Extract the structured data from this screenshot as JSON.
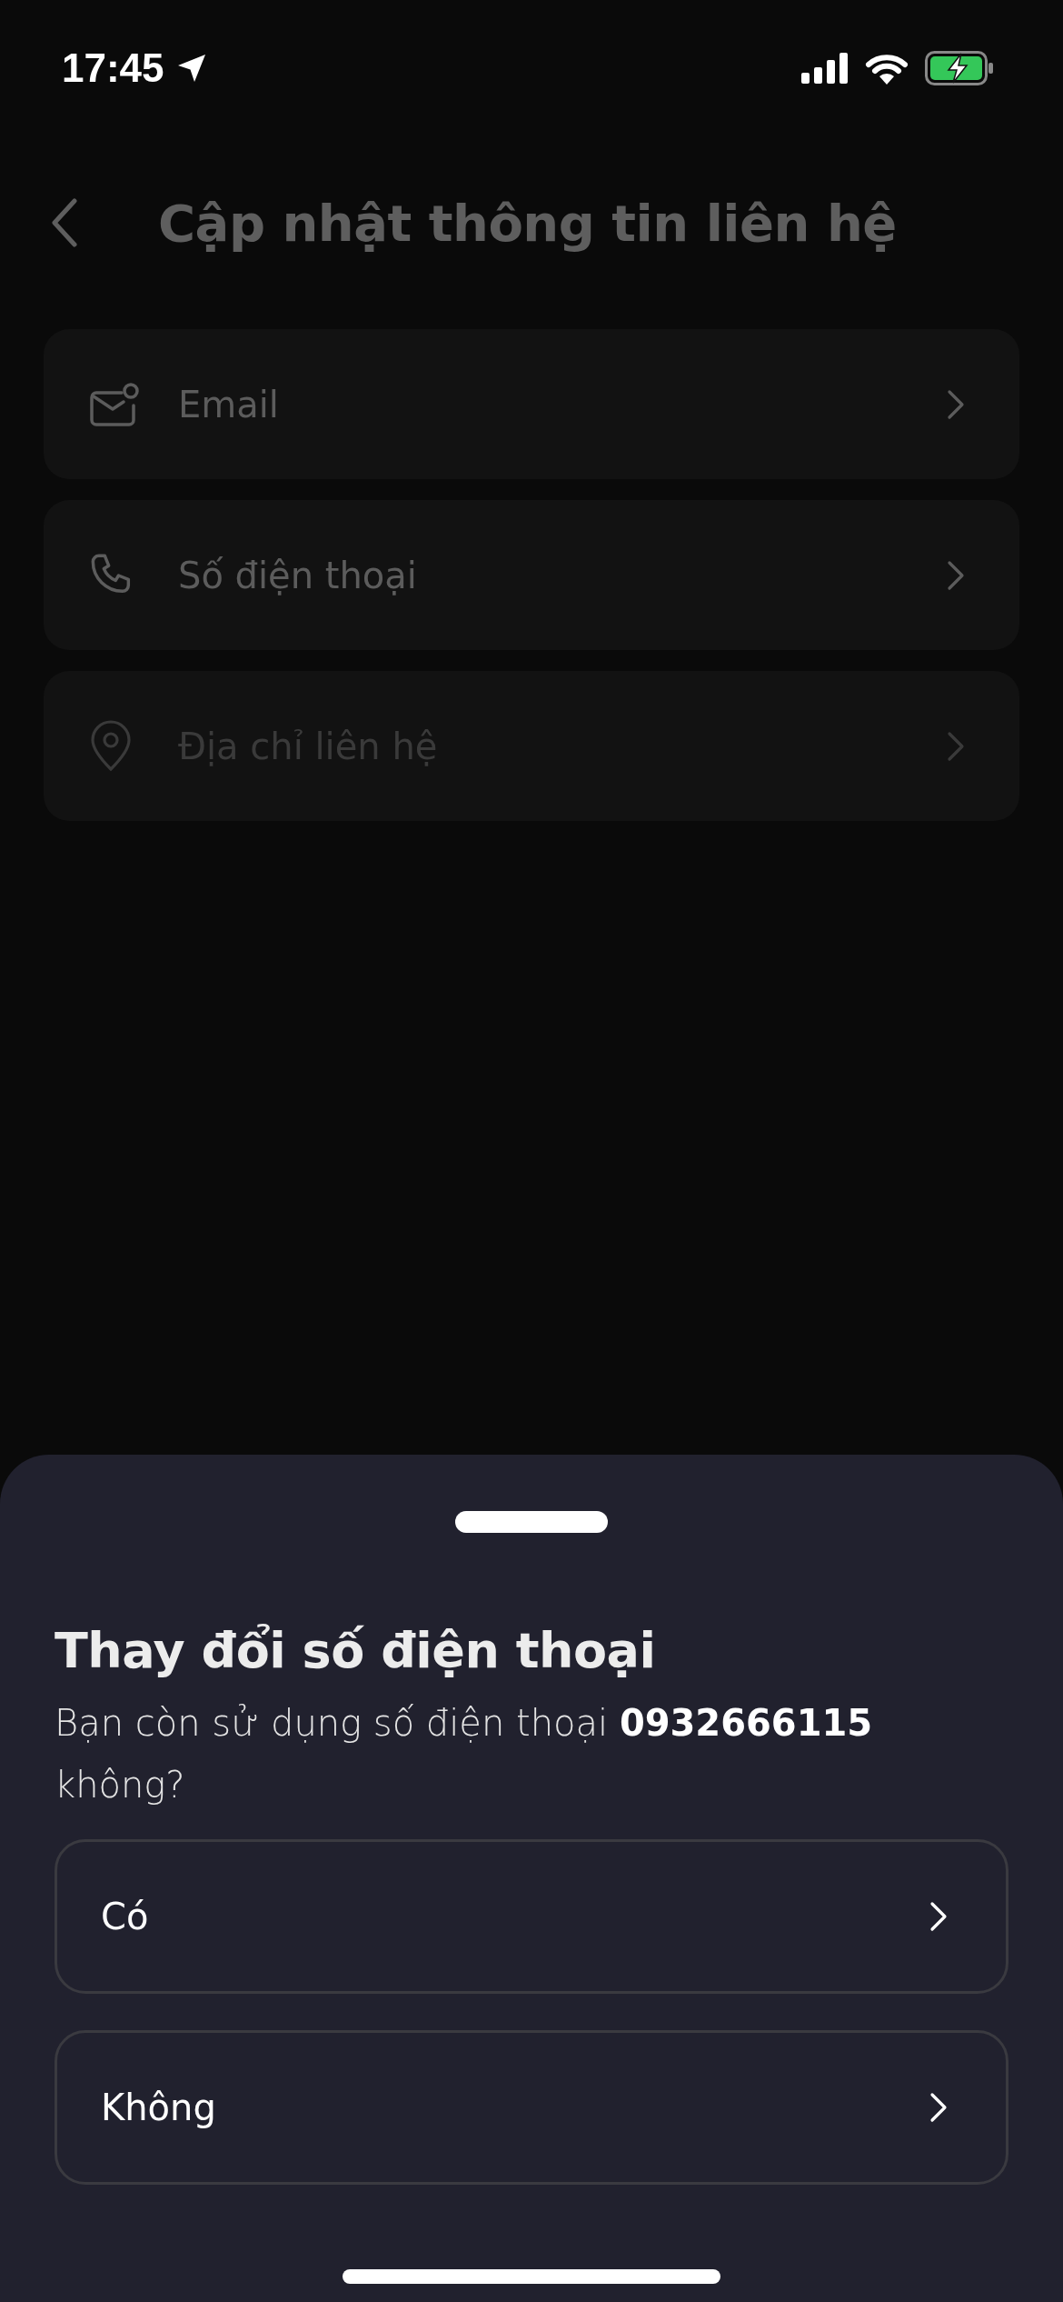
{
  "status_bar": {
    "time": "17:45"
  },
  "header": {
    "title": "Cập nhật thông tin liên hệ"
  },
  "items": [
    {
      "label": "Email",
      "disabled": false
    },
    {
      "label": "Số điện thoại",
      "disabled": false
    },
    {
      "label": "Địa chỉ liên hệ",
      "disabled": true
    }
  ],
  "sheet": {
    "title": "Thay đổi số điện thoại",
    "message": "Bạn còn sử dụng số điện thoại **0932666115** không?",
    "options": [
      {
        "label": "Có"
      },
      {
        "label": "Không"
      }
    ]
  }
}
